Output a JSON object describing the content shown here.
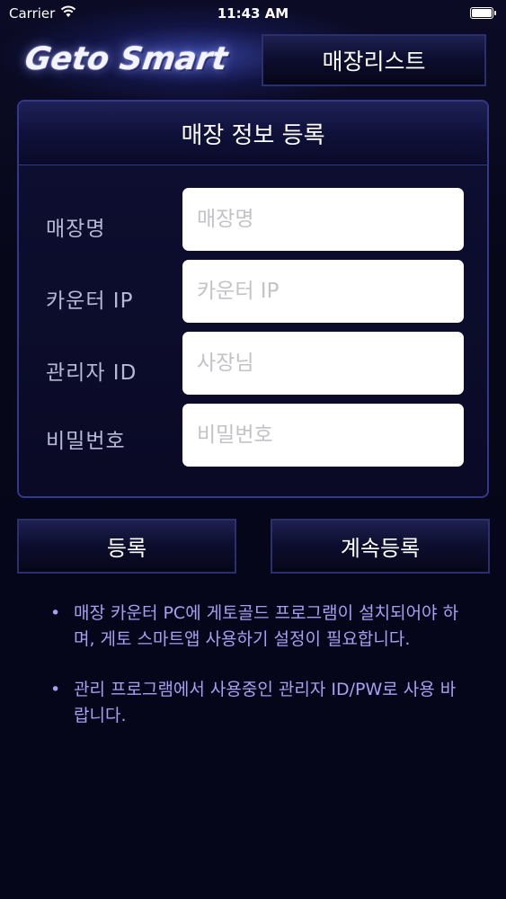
{
  "status_bar": {
    "carrier": "Carrier",
    "time": "11:43 AM"
  },
  "header": {
    "logo_text": "Geto Smart",
    "store_list_button": "매장리스트"
  },
  "form": {
    "title": "매장 정보 등록",
    "fields": [
      {
        "label": "매장명",
        "placeholder": "매장명",
        "value": ""
      },
      {
        "label": "카운터 IP",
        "placeholder": "카운터 IP",
        "value": ""
      },
      {
        "label": "관리자 ID",
        "placeholder": "사장님",
        "value": ""
      },
      {
        "label": "비밀번호",
        "placeholder": "비밀번호",
        "value": ""
      }
    ]
  },
  "actions": {
    "register": "등록",
    "continue_register": "계속등록"
  },
  "notes": [
    "매장 카운터 PC에 게토골드 프로그램이 설치되어야 하며, 게토 스마트앱 사용하기 설정이 필요합니다.",
    "관리 프로그램에서 사용중인 관리자 ID/PW로 사용 바랍니다."
  ],
  "colors": {
    "background": "#07071a",
    "panel_border": "#34378a",
    "note_text": "#a69ff2",
    "label_text": "#b8b9d8"
  }
}
